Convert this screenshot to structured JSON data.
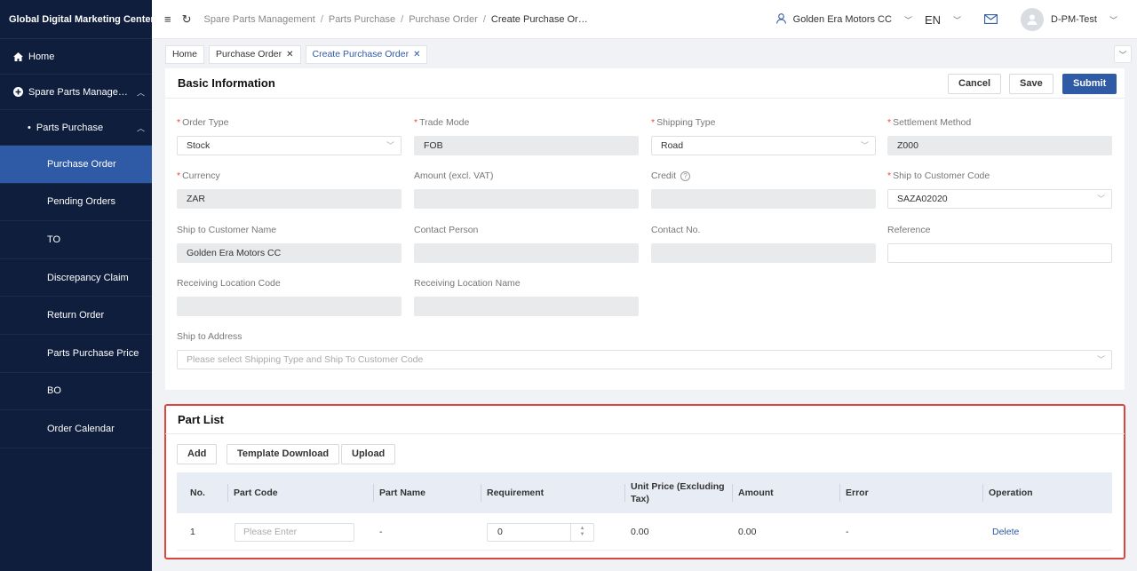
{
  "sidebar": {
    "title": "Global Digital Marketing Center",
    "home": "Home",
    "spare_parts": "Spare Parts Manage…",
    "parts_purchase": "Parts Purchase",
    "items": [
      "Purchase Order",
      "Pending Orders",
      "TO",
      "Discrepancy Claim",
      "Return Order",
      "Parts Purchase Price",
      "BO",
      "Order Calendar"
    ]
  },
  "topbar": {
    "breadcrumbs": [
      "Spare Parts Management",
      "Parts Purchase",
      "Purchase Order",
      "Create Purchase Or…"
    ],
    "dealer": "Golden Era Motors CC",
    "language": "EN",
    "username": "D-PM-Test"
  },
  "tabs": [
    {
      "label": "Home"
    },
    {
      "label": "Purchase Order"
    },
    {
      "label": "Create Purchase Order"
    }
  ],
  "basic": {
    "title": "Basic Information",
    "cancel": "Cancel",
    "save": "Save",
    "submit": "Submit",
    "fields": {
      "order_type": {
        "label": "Order Type",
        "value": "Stock"
      },
      "trade_mode": {
        "label": "Trade Mode",
        "value": "FOB"
      },
      "shipping_type": {
        "label": "Shipping Type",
        "value": "Road"
      },
      "settlement": {
        "label": "Settlement Method",
        "value": "Z000"
      },
      "currency": {
        "label": "Currency",
        "value": "ZAR"
      },
      "amount": {
        "label": "Amount (excl. VAT)",
        "value": ""
      },
      "credit": {
        "label": "Credit",
        "value": ""
      },
      "ship_code": {
        "label": "Ship to Customer Code",
        "value": "SAZA02020"
      },
      "ship_name": {
        "label": "Ship to Customer Name",
        "value": "Golden Era Motors CC"
      },
      "contact_person": {
        "label": "Contact Person",
        "value": ""
      },
      "contact_no": {
        "label": "Contact No.",
        "value": ""
      },
      "reference": {
        "label": "Reference",
        "value": ""
      },
      "recv_code": {
        "label": "Receiving Location Code",
        "value": ""
      },
      "recv_name": {
        "label": "Receiving Location Name",
        "value": ""
      },
      "ship_address": {
        "label": "Ship to Address",
        "placeholder": "Please select Shipping Type and Ship To Customer Code"
      }
    }
  },
  "part_list": {
    "title": "Part List",
    "add": "Add",
    "template": "Template Download",
    "upload": "Upload",
    "headers": [
      "No.",
      "Part Code",
      "Part Name",
      "Requirement",
      "Unit Price (Excluding Tax)",
      "Amount",
      "Error",
      "Operation"
    ],
    "row": {
      "no": "1",
      "part_code_placeholder": "Please Enter",
      "part_name": "-",
      "requirement": "0",
      "unit_price": "0.00",
      "amount": "0.00",
      "error": "-",
      "operation": "Delete"
    }
  }
}
